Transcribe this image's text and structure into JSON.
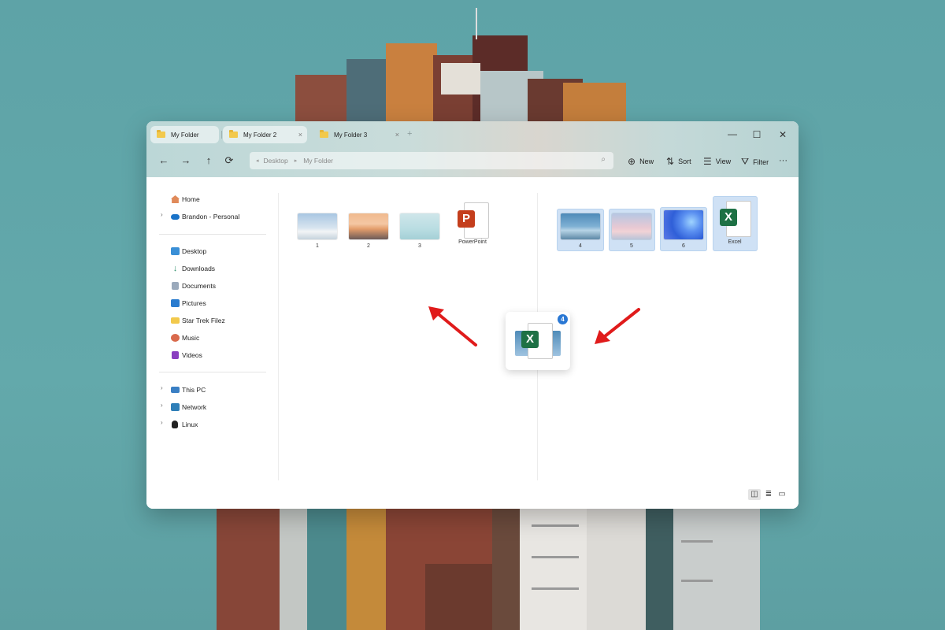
{
  "tabs": [
    {
      "label": "My Folder",
      "active": true
    },
    {
      "label": "My Folder 2",
      "active": false
    },
    {
      "label": "My Folder 3",
      "active": false
    }
  ],
  "icons": {
    "new_tab": "+",
    "tab_close": "×",
    "back": "←",
    "forward": "→",
    "up": "↑",
    "refresh": "⟳",
    "minimize": "—",
    "maximize": "☐",
    "close": "✕",
    "crumb_sep": "▸",
    "search": "⌕",
    "chevron": "›",
    "view_panes": "◫",
    "view_details": "≣",
    "view_preview": "▭"
  },
  "address": {
    "crumbs": [
      "Desktop",
      "My Folder"
    ]
  },
  "commands": [
    {
      "label": "New",
      "icon": "⊕"
    },
    {
      "label": "Sort",
      "icon": "⇅"
    },
    {
      "label": "View",
      "icon": "☰"
    },
    {
      "label": "Filter",
      "icon": "⛛"
    },
    {
      "label": "···",
      "icon": ""
    }
  ],
  "sidebar": {
    "items": [
      {
        "label": "Home",
        "icon": "home-icon"
      },
      {
        "label": "Brandon - Personal",
        "icon": "onedrive-icon"
      },
      {
        "label": "Desktop",
        "icon": "desktop-icon"
      },
      {
        "label": "Downloads",
        "icon": "downloads-icon"
      },
      {
        "label": "Documents",
        "icon": "documents-icon"
      },
      {
        "label": "Pictures",
        "icon": "pictures-icon"
      },
      {
        "label": "Star Trek Filez",
        "icon": "folder-icon"
      },
      {
        "label": "Music",
        "icon": "music-icon"
      },
      {
        "label": "Videos",
        "icon": "videos-icon"
      },
      {
        "label": "This PC",
        "icon": "pc-icon"
      },
      {
        "label": "Network",
        "icon": "network-icon"
      },
      {
        "label": "Linux",
        "icon": "linux-icon"
      }
    ]
  },
  "left_pane": {
    "files": [
      {
        "name": "1",
        "type": "image"
      },
      {
        "name": "2",
        "type": "image"
      },
      {
        "name": "3",
        "type": "image"
      },
      {
        "name": "PowerPoint",
        "type": "pptx",
        "badge": "P"
      }
    ]
  },
  "right_pane": {
    "files": [
      {
        "name": "4",
        "type": "image",
        "selected": true
      },
      {
        "name": "5",
        "type": "image",
        "selected": true
      },
      {
        "name": "6",
        "type": "image",
        "selected": true
      },
      {
        "name": "Excel",
        "type": "xlsx",
        "badge": "X",
        "selected": true
      }
    ]
  },
  "drag_preview": {
    "count": "4",
    "badge": "X"
  },
  "colors": {
    "selection": "#cfe1f5",
    "excel": "#1e7145",
    "powerpoint": "#c43e1c",
    "arrow": "#e01b1b"
  }
}
